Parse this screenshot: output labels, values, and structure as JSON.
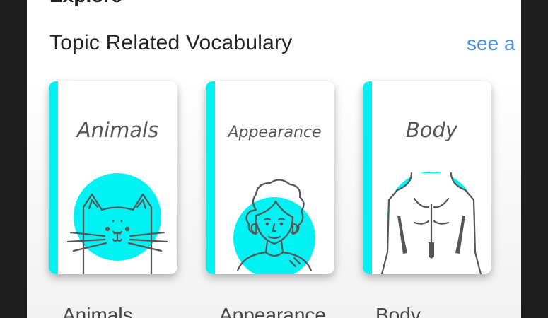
{
  "header": {
    "partial_title": "Explore"
  },
  "section": {
    "title": "Topic Related Vocabulary",
    "see_all": "see a"
  },
  "topics": [
    {
      "card_title": "Animals",
      "label": "Animals",
      "icon": "cat-icon"
    },
    {
      "card_title": "Appearance",
      "label": "Appearance",
      "icon": "woman-face-icon"
    },
    {
      "card_title": "Body",
      "label": "Body",
      "icon": "back-anatomy-icon"
    }
  ],
  "colors": {
    "accent": "#00f2f2",
    "link": "#4a90e2",
    "text": "#222222"
  }
}
